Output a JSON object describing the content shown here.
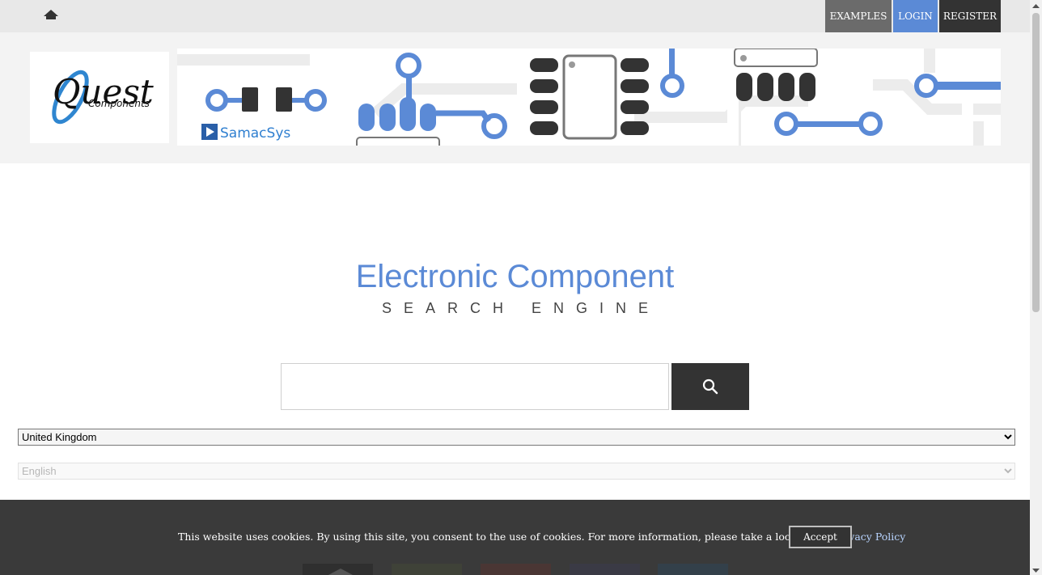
{
  "nav": {
    "home_icon": "home-icon",
    "examples_label": "EXAMPLES",
    "login_label": "LOGIN",
    "register_label": "REGISTER",
    "colors": {
      "examples_bg": "#6b6b6b",
      "login_bg": "#5b8ad6",
      "register_bg": "#333333"
    }
  },
  "banner": {
    "logo_brand": "Quest",
    "logo_sub": "Components",
    "partner_brand": "SamacSys"
  },
  "hero": {
    "title": "Electronic Component",
    "subtitle": "SEARCH ENGINE"
  },
  "search": {
    "value": "",
    "placeholder": "",
    "button_icon": "search-icon"
  },
  "selects": {
    "country": "United Kingdom",
    "language": "English"
  },
  "cookie": {
    "text": "This website uses cookies. By using this site, you consent to the use of cookies. For more information, please take a look at our",
    "link_label": "Privacy Policy",
    "accept_label": "Accept"
  },
  "colors": {
    "accent": "#5b8ad6",
    "dark": "#333333",
    "footer_bg": "#3a3a3a"
  }
}
